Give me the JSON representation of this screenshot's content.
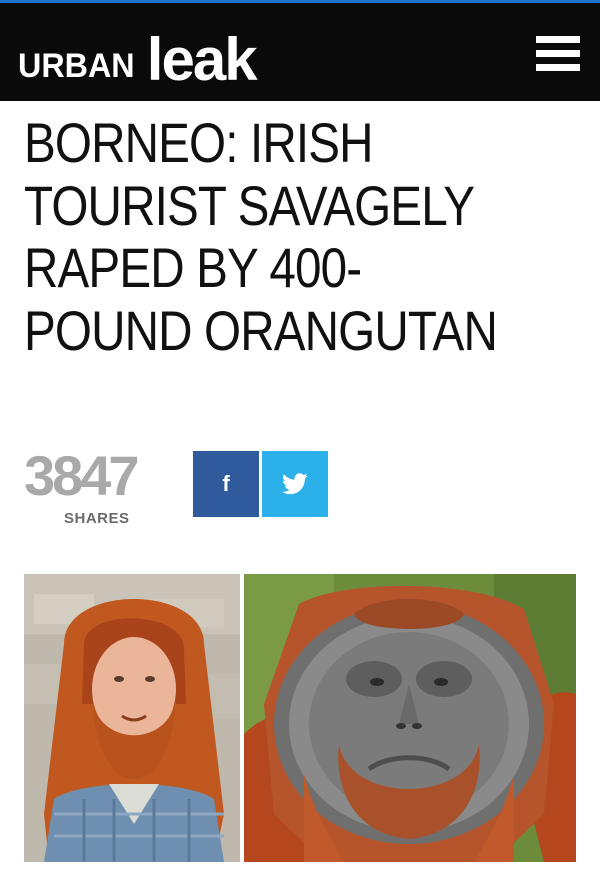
{
  "site": {
    "logo_urban": "URBAN",
    "logo_leak": "leak",
    "menu_icon": "hamburger-menu-icon",
    "accent_color": "#1a73c8"
  },
  "article": {
    "headline": "BORNEO: IRISH TOURIST SAVAGELY RAPED BY 400-POUND ORANGUTAN"
  },
  "share": {
    "count": "3847",
    "label": "SHARES",
    "facebook_glyph": "f",
    "facebook_icon": "facebook-icon",
    "twitter_icon": "twitter-bird-icon",
    "facebook_color": "#2f5b9c",
    "twitter_color": "#2bb0ea"
  },
  "images": {
    "left": "photo-red-haired-man",
    "right": "photo-orangutan"
  }
}
